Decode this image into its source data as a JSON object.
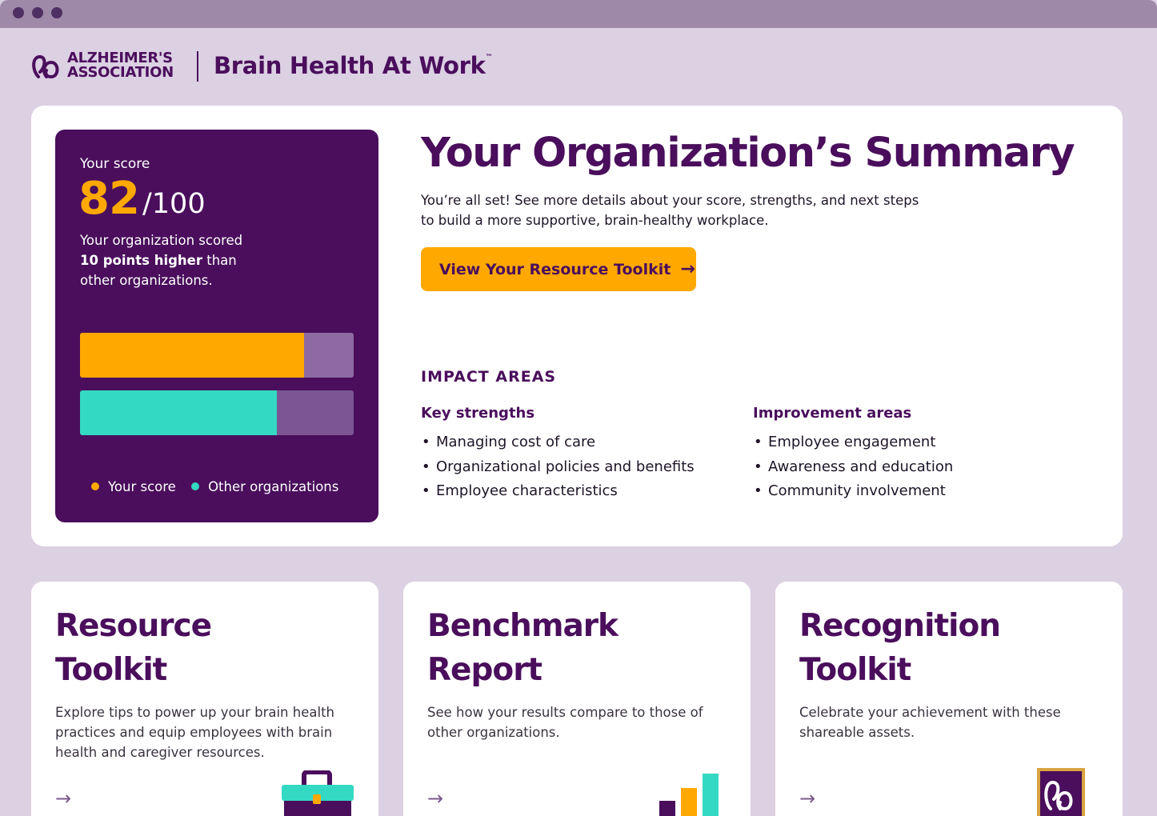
{
  "header": {
    "logo_line1": "ALZHEIMER'S",
    "logo_line2": "ASSOCIATION",
    "brand_title": "Brain Health At Work",
    "brand_tm": "™"
  },
  "score_panel": {
    "label": "Your score",
    "value": "82",
    "max": "/100",
    "desc_line1": "Your organization scored",
    "desc_bold": "10 points higher",
    "desc_mid": " than",
    "desc_line3": "other organizations.",
    "legend": [
      {
        "label": "Your score",
        "color": "#ffa800"
      },
      {
        "label": "Other organizations",
        "color": "#33d9c2"
      }
    ]
  },
  "chart_data": {
    "type": "bar",
    "orientation": "horizontal",
    "max": 100,
    "series": [
      {
        "name": "Your score",
        "value": 82,
        "color": "#ffa800"
      },
      {
        "name": "Other organizations",
        "value": 72,
        "color": "#33d9c2"
      }
    ]
  },
  "summary": {
    "title": "Your Organization’s Summary",
    "intro_line1": "You’re all set! See more details about your score, strengths, and next steps",
    "intro_line2": "to build a more supportive, brain-healthy workplace.",
    "cta_label": "View Your Resource Toolkit",
    "cta_icon": "arrow-right-icon"
  },
  "impact": {
    "heading": "IMPACT AREAS",
    "strengths_heading": "Key strengths",
    "strengths": [
      "Managing cost of care",
      "Organizational policies and benefits",
      "Employee characteristics"
    ],
    "improvements_heading": "Improvement areas",
    "improvements": [
      "Employee engagement",
      "Awareness and education",
      "Community involvement"
    ]
  },
  "cards": [
    {
      "title_line1": "Resource",
      "title_line2": "Toolkit",
      "desc": "Explore tips to power up your brain health practices and equip employees with brain health and caregiver resources.",
      "icon": "toolbox-icon"
    },
    {
      "title_line1": "Benchmark",
      "title_line2": "Report",
      "desc": "See how your results compare to those of other organizations.",
      "icon": "bar-chart-icon"
    },
    {
      "title_line1": "Recognition",
      "title_line2": "Toolkit",
      "desc": "Celebrate your achievement with these shareable assets.",
      "icon": "badge-icon"
    }
  ],
  "colors": {
    "brand_purple": "#4a0e5c",
    "accent_orange": "#ffa800",
    "accent_teal": "#33d9c2",
    "background": "#dcd0e3"
  }
}
